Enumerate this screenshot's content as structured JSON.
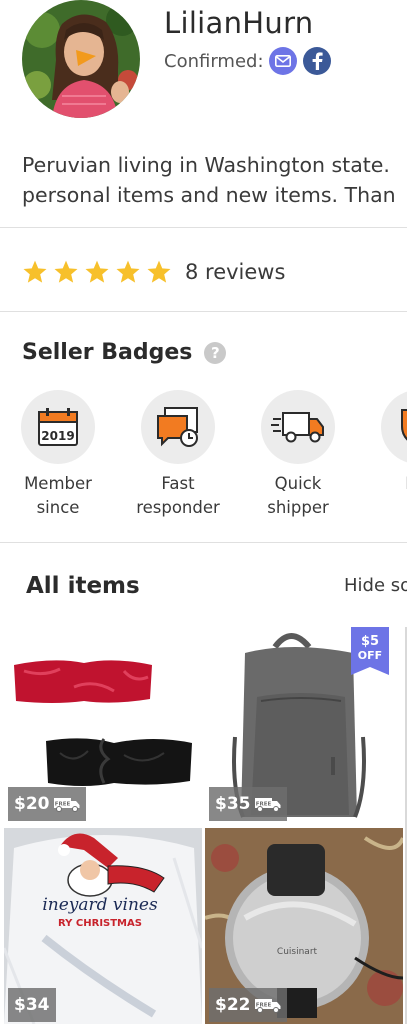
{
  "profile": {
    "username": "LilianHurn",
    "confirmed_label": "Confirmed:",
    "bio_line1": "Peruvian living in Washington state.",
    "bio_line2": "personal items and new items. Than"
  },
  "reviews": {
    "rating": 5,
    "label": "8 reviews",
    "star_color": "#f7c02b"
  },
  "badges": {
    "title": "Seller Badges",
    "help_symbol": "?",
    "items": [
      {
        "line1": "Member",
        "line2": "since",
        "icon": "calendar-icon",
        "year": "2019"
      },
      {
        "line1": "Fast",
        "line2": "responder",
        "icon": "chat-clock-icon"
      },
      {
        "line1": "Quick",
        "line2": "shipper",
        "icon": "truck-icon"
      },
      {
        "line1": "Rel",
        "line2": "",
        "icon": "shield-icon"
      }
    ]
  },
  "items_section": {
    "title": "All items",
    "hide_sold_label": "Hide so"
  },
  "listings": [
    {
      "price": "$20",
      "free_shipping": true,
      "image": "headbands"
    },
    {
      "price": "$35",
      "free_shipping": true,
      "image": "backpack",
      "discount_amount": "$5",
      "discount_word": "OFF"
    },
    {
      "price": "$34",
      "free_shipping": false,
      "image": "long-sleeve-shirt",
      "shirt_brand": "ineyard vines",
      "shirt_text": "RY CHRISTMAS"
    },
    {
      "price": "$22",
      "free_shipping": true,
      "image": "waffle-maker",
      "brand_text": "Cuisinart"
    }
  ],
  "free_ship_text": "FREE",
  "colors": {
    "accent_orange": "#f27b21",
    "email_badge": "#6d74e6",
    "facebook_badge": "#3b5998",
    "discount_badge": "#6d74e6"
  }
}
